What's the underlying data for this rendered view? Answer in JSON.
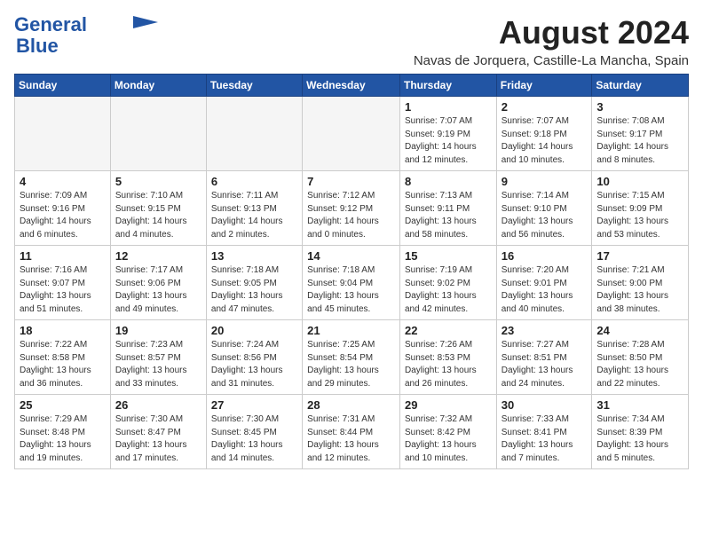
{
  "logo": {
    "line1": "General",
    "line2": "Blue"
  },
  "title": "August 2024",
  "location": "Navas de Jorquera, Castille-La Mancha, Spain",
  "weekdays": [
    "Sunday",
    "Monday",
    "Tuesday",
    "Wednesday",
    "Thursday",
    "Friday",
    "Saturday"
  ],
  "weeks": [
    [
      {
        "day": "",
        "info": ""
      },
      {
        "day": "",
        "info": ""
      },
      {
        "day": "",
        "info": ""
      },
      {
        "day": "",
        "info": ""
      },
      {
        "day": "1",
        "info": "Sunrise: 7:07 AM\nSunset: 9:19 PM\nDaylight: 14 hours\nand 12 minutes."
      },
      {
        "day": "2",
        "info": "Sunrise: 7:07 AM\nSunset: 9:18 PM\nDaylight: 14 hours\nand 10 minutes."
      },
      {
        "day": "3",
        "info": "Sunrise: 7:08 AM\nSunset: 9:17 PM\nDaylight: 14 hours\nand 8 minutes."
      }
    ],
    [
      {
        "day": "4",
        "info": "Sunrise: 7:09 AM\nSunset: 9:16 PM\nDaylight: 14 hours\nand 6 minutes."
      },
      {
        "day": "5",
        "info": "Sunrise: 7:10 AM\nSunset: 9:15 PM\nDaylight: 14 hours\nand 4 minutes."
      },
      {
        "day": "6",
        "info": "Sunrise: 7:11 AM\nSunset: 9:13 PM\nDaylight: 14 hours\nand 2 minutes."
      },
      {
        "day": "7",
        "info": "Sunrise: 7:12 AM\nSunset: 9:12 PM\nDaylight: 14 hours\nand 0 minutes."
      },
      {
        "day": "8",
        "info": "Sunrise: 7:13 AM\nSunset: 9:11 PM\nDaylight: 13 hours\nand 58 minutes."
      },
      {
        "day": "9",
        "info": "Sunrise: 7:14 AM\nSunset: 9:10 PM\nDaylight: 13 hours\nand 56 minutes."
      },
      {
        "day": "10",
        "info": "Sunrise: 7:15 AM\nSunset: 9:09 PM\nDaylight: 13 hours\nand 53 minutes."
      }
    ],
    [
      {
        "day": "11",
        "info": "Sunrise: 7:16 AM\nSunset: 9:07 PM\nDaylight: 13 hours\nand 51 minutes."
      },
      {
        "day": "12",
        "info": "Sunrise: 7:17 AM\nSunset: 9:06 PM\nDaylight: 13 hours\nand 49 minutes."
      },
      {
        "day": "13",
        "info": "Sunrise: 7:18 AM\nSunset: 9:05 PM\nDaylight: 13 hours\nand 47 minutes."
      },
      {
        "day": "14",
        "info": "Sunrise: 7:18 AM\nSunset: 9:04 PM\nDaylight: 13 hours\nand 45 minutes."
      },
      {
        "day": "15",
        "info": "Sunrise: 7:19 AM\nSunset: 9:02 PM\nDaylight: 13 hours\nand 42 minutes."
      },
      {
        "day": "16",
        "info": "Sunrise: 7:20 AM\nSunset: 9:01 PM\nDaylight: 13 hours\nand 40 minutes."
      },
      {
        "day": "17",
        "info": "Sunrise: 7:21 AM\nSunset: 9:00 PM\nDaylight: 13 hours\nand 38 minutes."
      }
    ],
    [
      {
        "day": "18",
        "info": "Sunrise: 7:22 AM\nSunset: 8:58 PM\nDaylight: 13 hours\nand 36 minutes."
      },
      {
        "day": "19",
        "info": "Sunrise: 7:23 AM\nSunset: 8:57 PM\nDaylight: 13 hours\nand 33 minutes."
      },
      {
        "day": "20",
        "info": "Sunrise: 7:24 AM\nSunset: 8:56 PM\nDaylight: 13 hours\nand 31 minutes."
      },
      {
        "day": "21",
        "info": "Sunrise: 7:25 AM\nSunset: 8:54 PM\nDaylight: 13 hours\nand 29 minutes."
      },
      {
        "day": "22",
        "info": "Sunrise: 7:26 AM\nSunset: 8:53 PM\nDaylight: 13 hours\nand 26 minutes."
      },
      {
        "day": "23",
        "info": "Sunrise: 7:27 AM\nSunset: 8:51 PM\nDaylight: 13 hours\nand 24 minutes."
      },
      {
        "day": "24",
        "info": "Sunrise: 7:28 AM\nSunset: 8:50 PM\nDaylight: 13 hours\nand 22 minutes."
      }
    ],
    [
      {
        "day": "25",
        "info": "Sunrise: 7:29 AM\nSunset: 8:48 PM\nDaylight: 13 hours\nand 19 minutes."
      },
      {
        "day": "26",
        "info": "Sunrise: 7:30 AM\nSunset: 8:47 PM\nDaylight: 13 hours\nand 17 minutes."
      },
      {
        "day": "27",
        "info": "Sunrise: 7:30 AM\nSunset: 8:45 PM\nDaylight: 13 hours\nand 14 minutes."
      },
      {
        "day": "28",
        "info": "Sunrise: 7:31 AM\nSunset: 8:44 PM\nDaylight: 13 hours\nand 12 minutes."
      },
      {
        "day": "29",
        "info": "Sunrise: 7:32 AM\nSunset: 8:42 PM\nDaylight: 13 hours\nand 10 minutes."
      },
      {
        "day": "30",
        "info": "Sunrise: 7:33 AM\nSunset: 8:41 PM\nDaylight: 13 hours\nand 7 minutes."
      },
      {
        "day": "31",
        "info": "Sunrise: 7:34 AM\nSunset: 8:39 PM\nDaylight: 13 hours\nand 5 minutes."
      }
    ]
  ]
}
